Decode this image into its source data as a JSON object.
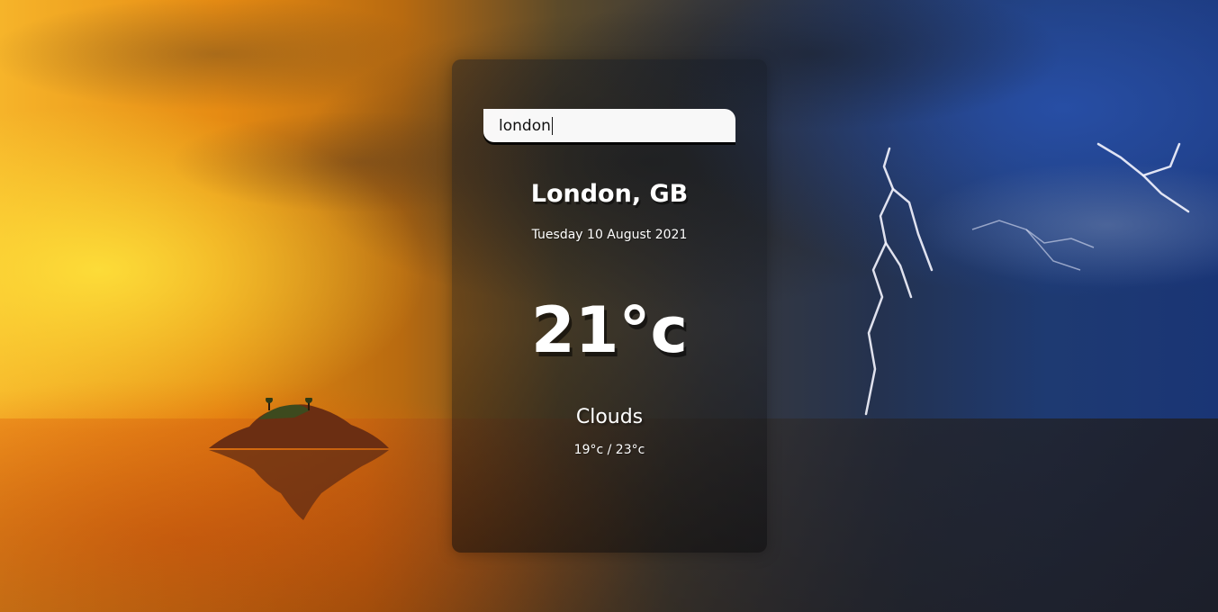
{
  "search": {
    "value": "london"
  },
  "weather": {
    "location": "London, GB",
    "date": "Tuesday 10 August 2021",
    "temperature": "21°c",
    "condition": "Clouds",
    "hi_low": "19°c / 23°c"
  }
}
